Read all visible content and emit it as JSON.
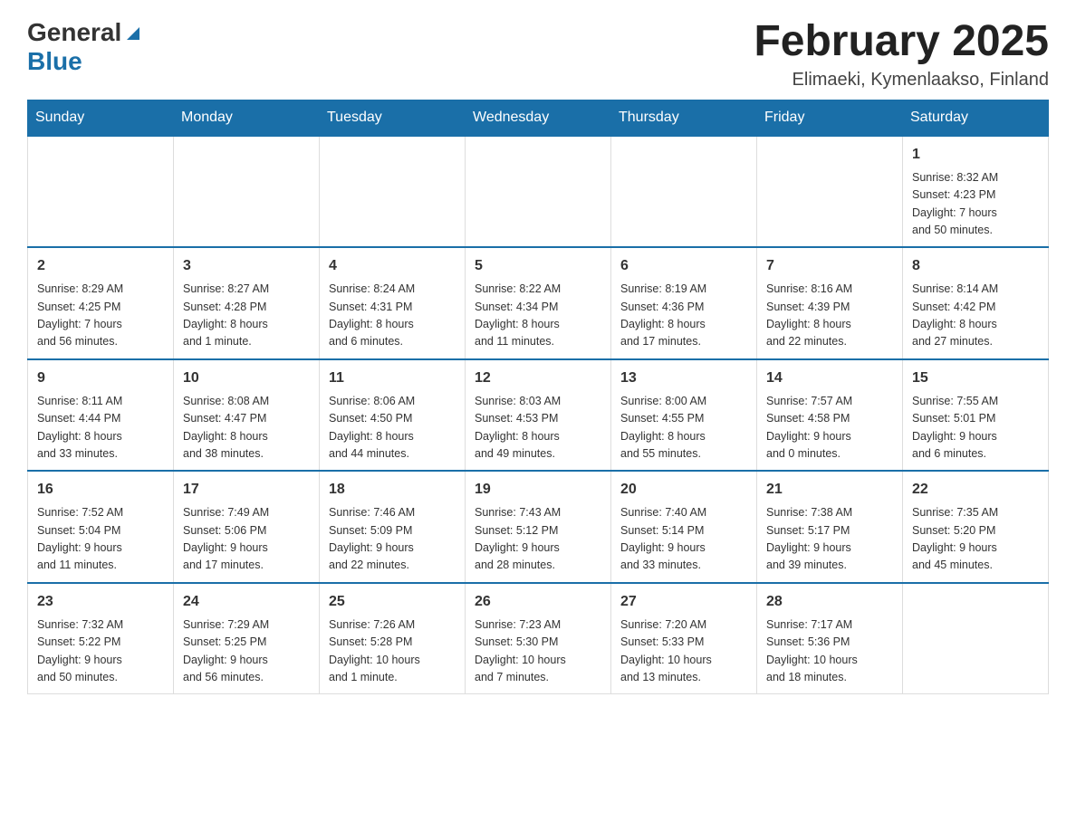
{
  "header": {
    "logo_general": "General",
    "logo_blue": "Blue",
    "title": "February 2025",
    "subtitle": "Elimaeki, Kymenlaakso, Finland"
  },
  "days_of_week": [
    "Sunday",
    "Monday",
    "Tuesday",
    "Wednesday",
    "Thursday",
    "Friday",
    "Saturday"
  ],
  "weeks": [
    [
      {
        "day": "",
        "info": ""
      },
      {
        "day": "",
        "info": ""
      },
      {
        "day": "",
        "info": ""
      },
      {
        "day": "",
        "info": ""
      },
      {
        "day": "",
        "info": ""
      },
      {
        "day": "",
        "info": ""
      },
      {
        "day": "1",
        "info": "Sunrise: 8:32 AM\nSunset: 4:23 PM\nDaylight: 7 hours\nand 50 minutes."
      }
    ],
    [
      {
        "day": "2",
        "info": "Sunrise: 8:29 AM\nSunset: 4:25 PM\nDaylight: 7 hours\nand 56 minutes."
      },
      {
        "day": "3",
        "info": "Sunrise: 8:27 AM\nSunset: 4:28 PM\nDaylight: 8 hours\nand 1 minute."
      },
      {
        "day": "4",
        "info": "Sunrise: 8:24 AM\nSunset: 4:31 PM\nDaylight: 8 hours\nand 6 minutes."
      },
      {
        "day": "5",
        "info": "Sunrise: 8:22 AM\nSunset: 4:34 PM\nDaylight: 8 hours\nand 11 minutes."
      },
      {
        "day": "6",
        "info": "Sunrise: 8:19 AM\nSunset: 4:36 PM\nDaylight: 8 hours\nand 17 minutes."
      },
      {
        "day": "7",
        "info": "Sunrise: 8:16 AM\nSunset: 4:39 PM\nDaylight: 8 hours\nand 22 minutes."
      },
      {
        "day": "8",
        "info": "Sunrise: 8:14 AM\nSunset: 4:42 PM\nDaylight: 8 hours\nand 27 minutes."
      }
    ],
    [
      {
        "day": "9",
        "info": "Sunrise: 8:11 AM\nSunset: 4:44 PM\nDaylight: 8 hours\nand 33 minutes."
      },
      {
        "day": "10",
        "info": "Sunrise: 8:08 AM\nSunset: 4:47 PM\nDaylight: 8 hours\nand 38 minutes."
      },
      {
        "day": "11",
        "info": "Sunrise: 8:06 AM\nSunset: 4:50 PM\nDaylight: 8 hours\nand 44 minutes."
      },
      {
        "day": "12",
        "info": "Sunrise: 8:03 AM\nSunset: 4:53 PM\nDaylight: 8 hours\nand 49 minutes."
      },
      {
        "day": "13",
        "info": "Sunrise: 8:00 AM\nSunset: 4:55 PM\nDaylight: 8 hours\nand 55 minutes."
      },
      {
        "day": "14",
        "info": "Sunrise: 7:57 AM\nSunset: 4:58 PM\nDaylight: 9 hours\nand 0 minutes."
      },
      {
        "day": "15",
        "info": "Sunrise: 7:55 AM\nSunset: 5:01 PM\nDaylight: 9 hours\nand 6 minutes."
      }
    ],
    [
      {
        "day": "16",
        "info": "Sunrise: 7:52 AM\nSunset: 5:04 PM\nDaylight: 9 hours\nand 11 minutes."
      },
      {
        "day": "17",
        "info": "Sunrise: 7:49 AM\nSunset: 5:06 PM\nDaylight: 9 hours\nand 17 minutes."
      },
      {
        "day": "18",
        "info": "Sunrise: 7:46 AM\nSunset: 5:09 PM\nDaylight: 9 hours\nand 22 minutes."
      },
      {
        "day": "19",
        "info": "Sunrise: 7:43 AM\nSunset: 5:12 PM\nDaylight: 9 hours\nand 28 minutes."
      },
      {
        "day": "20",
        "info": "Sunrise: 7:40 AM\nSunset: 5:14 PM\nDaylight: 9 hours\nand 33 minutes."
      },
      {
        "day": "21",
        "info": "Sunrise: 7:38 AM\nSunset: 5:17 PM\nDaylight: 9 hours\nand 39 minutes."
      },
      {
        "day": "22",
        "info": "Sunrise: 7:35 AM\nSunset: 5:20 PM\nDaylight: 9 hours\nand 45 minutes."
      }
    ],
    [
      {
        "day": "23",
        "info": "Sunrise: 7:32 AM\nSunset: 5:22 PM\nDaylight: 9 hours\nand 50 minutes."
      },
      {
        "day": "24",
        "info": "Sunrise: 7:29 AM\nSunset: 5:25 PM\nDaylight: 9 hours\nand 56 minutes."
      },
      {
        "day": "25",
        "info": "Sunrise: 7:26 AM\nSunset: 5:28 PM\nDaylight: 10 hours\nand 1 minute."
      },
      {
        "day": "26",
        "info": "Sunrise: 7:23 AM\nSunset: 5:30 PM\nDaylight: 10 hours\nand 7 minutes."
      },
      {
        "day": "27",
        "info": "Sunrise: 7:20 AM\nSunset: 5:33 PM\nDaylight: 10 hours\nand 13 minutes."
      },
      {
        "day": "28",
        "info": "Sunrise: 7:17 AM\nSunset: 5:36 PM\nDaylight: 10 hours\nand 18 minutes."
      },
      {
        "day": "",
        "info": ""
      }
    ]
  ]
}
